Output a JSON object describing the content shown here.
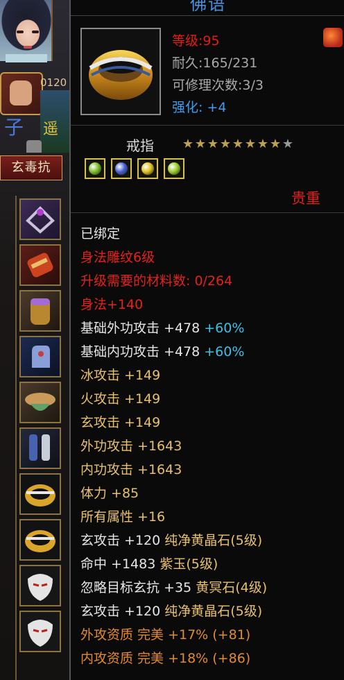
{
  "left_hud": {
    "level_text": "0120",
    "status_tag": "玄毒抗",
    "glyph_blue": "子",
    "glyph_yellow": "遥",
    "equipment_slots": [
      {
        "icon": "ring-jewel-icon"
      },
      {
        "icon": "bracer-icon"
      },
      {
        "icon": "wrist-guard-icon"
      },
      {
        "icon": "gauntlet-icon"
      },
      {
        "icon": "belt-icon"
      },
      {
        "icon": "boots-icon"
      },
      {
        "icon": "ring-icon"
      },
      {
        "icon": "ring-icon"
      },
      {
        "icon": "mask-icon"
      },
      {
        "icon": "mask-icon"
      }
    ]
  },
  "item": {
    "name": "佛语",
    "level": "等级:95",
    "durability": "耐久:165/231",
    "repair_count": "可修理次数:3/3",
    "enhance": "强化: +4",
    "type": "戒指",
    "stars_total": 9,
    "stars_lit": 8,
    "rarity": "贵重",
    "sockets": [
      {
        "gem": "green-gem-icon",
        "color": "#7fbf2a"
      },
      {
        "gem": "blue-gem-icon",
        "color": "#4a63d6"
      },
      {
        "gem": "yellow-gem-icon",
        "color": "#e2c21d"
      },
      {
        "gem": "green-gem-icon",
        "color": "#9ccd2c"
      }
    ],
    "colors": {
      "level": "#e21d14",
      "enhance": "#3f9cf2",
      "rarity": "#e2211a",
      "bound": "#e6e6e6",
      "engrave": "#e3221a",
      "attribute": "#e8c06b",
      "percent": "#38c2e8",
      "quality": "#e38a2a"
    },
    "attributes": [
      {
        "parts": [
          {
            "text": "已绑定",
            "color": "white"
          }
        ]
      },
      {
        "parts": [
          {
            "text": "身法雕纹6级",
            "color": "red"
          }
        ]
      },
      {
        "parts": [
          {
            "text": "升级需要的材料数: 0/264",
            "color": "red"
          }
        ]
      },
      {
        "parts": [
          {
            "text": "身法+140",
            "color": "red"
          }
        ]
      },
      {
        "parts": [
          {
            "text": "基础外功攻击 +478 ",
            "color": "white"
          },
          {
            "text": "+60%",
            "color": "cyan"
          }
        ]
      },
      {
        "parts": [
          {
            "text": "基础内功攻击 +478 ",
            "color": "white"
          },
          {
            "text": "+60%",
            "color": "cyan"
          }
        ]
      },
      {
        "parts": [
          {
            "text": "冰攻击 +149",
            "color": "yellow"
          }
        ]
      },
      {
        "parts": [
          {
            "text": "火攻击 +149",
            "color": "yellow"
          }
        ]
      },
      {
        "parts": [
          {
            "text": "玄攻击 +149",
            "color": "yellow"
          }
        ]
      },
      {
        "parts": [
          {
            "text": "外功攻击 +1643",
            "color": "yellow"
          }
        ]
      },
      {
        "parts": [
          {
            "text": "内功攻击 +1643",
            "color": "yellow"
          }
        ]
      },
      {
        "parts": [
          {
            "text": "体力 +85",
            "color": "yellow"
          }
        ]
      },
      {
        "parts": [
          {
            "text": "所有属性 +16",
            "color": "yellow"
          }
        ]
      },
      {
        "parts": [
          {
            "text": "玄攻击 +120 ",
            "color": "white"
          },
          {
            "text": "纯净黄晶石(5级)",
            "color": "yellow"
          }
        ]
      },
      {
        "parts": [
          {
            "text": "命中 +1483 ",
            "color": "white"
          },
          {
            "text": "紫玉(5级)",
            "color": "yellow"
          }
        ]
      },
      {
        "parts": [
          {
            "text": "忽略目标玄抗 +35 ",
            "color": "white"
          },
          {
            "text": "黄冥石(4级)",
            "color": "yellow"
          }
        ]
      },
      {
        "parts": [
          {
            "text": "玄攻击 +120 ",
            "color": "white"
          },
          {
            "text": "纯净黄晶石(5级)",
            "color": "yellow"
          }
        ]
      },
      {
        "parts": [
          {
            "text": "外攻资质  完美 +17% (+81)",
            "color": "orange"
          }
        ]
      },
      {
        "parts": [
          {
            "text": "内攻资质  完美 +18% (+86)",
            "color": "orange"
          }
        ]
      }
    ]
  }
}
